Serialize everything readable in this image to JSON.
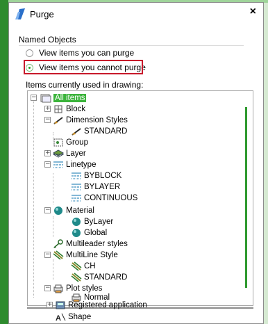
{
  "window": {
    "title": "Purge",
    "close_glyph": "×"
  },
  "named_objects": {
    "group_label": "Named Objects",
    "option_can_purge": "View items you can purge",
    "option_cannot_purge": "View items you cannot purge",
    "selected_option": "View items you cannot purge"
  },
  "tree": {
    "label": "Items currently used in drawing:",
    "root": "All items",
    "block": "Block",
    "dimension_styles": "Dimension Styles",
    "dim_standard": "STANDARD",
    "group": "Group",
    "layer": "Layer",
    "linetype": "Linetype",
    "lt_byblock": "BYBLOCK",
    "lt_bylayer": "BYLAYER",
    "lt_continuous": "CONTINUOUS",
    "material": "Material",
    "mat_bylayer": "ByLayer",
    "mat_global": "Global",
    "multileader_styles": "Multileader styles",
    "multiline_style": "MultiLine Style",
    "ml_ch": "CH",
    "ml_standard": "STANDARD",
    "plot_styles": "Plot styles",
    "ps_normal": "Normal",
    "registered_application": "Registered application",
    "shape": "Shape"
  },
  "colors": {
    "accent_green": "#3cb43c",
    "highlight_red": "#c8192b"
  }
}
